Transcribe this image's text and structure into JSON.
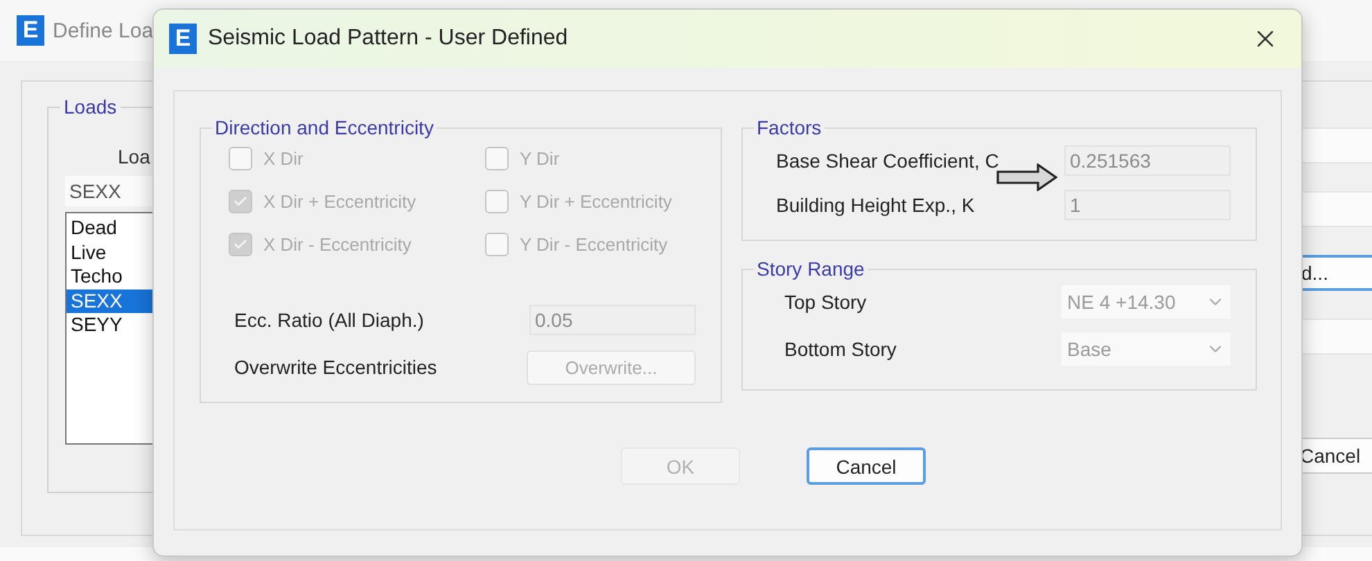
{
  "background_window": {
    "app_letter": "E",
    "title": "Define Loa",
    "loads_group": {
      "title": "Loads",
      "label": "Loa",
      "field_value": "SEXX",
      "items": [
        {
          "label": "Dead",
          "selected": false
        },
        {
          "label": "Live",
          "selected": false
        },
        {
          "label": "Techo",
          "selected": false
        },
        {
          "label": "SEXX",
          "selected": true
        },
        {
          "label": "SEYY",
          "selected": false
        }
      ]
    },
    "side_buttons": [
      "d...",
      "Cancel"
    ]
  },
  "dialog": {
    "app_letter": "E",
    "title": "Seismic Load Pattern - User Defined",
    "direction_group": {
      "title": "Direction and Eccentricity",
      "options": [
        {
          "label": "X Dir",
          "checked": false,
          "disabled": true
        },
        {
          "label": "Y Dir",
          "checked": false,
          "disabled": true
        },
        {
          "label": "X Dir + Eccentricity",
          "checked": true,
          "disabled": true
        },
        {
          "label": "Y Dir + Eccentricity",
          "checked": false,
          "disabled": true
        },
        {
          "label": "X Dir - Eccentricity",
          "checked": true,
          "disabled": true
        },
        {
          "label": "Y Dir - Eccentricity",
          "checked": false,
          "disabled": true
        }
      ],
      "ecc_ratio": {
        "label": "Ecc. Ratio (All Diaph.)",
        "value": "0.05"
      },
      "overwrite": {
        "label": "Overwrite Eccentricities",
        "button": "Overwrite...",
        "disabled": true
      }
    },
    "factors": {
      "title": "Factors",
      "fields": [
        {
          "label": "Base Shear Coefficient, C",
          "value": "0.251563"
        },
        {
          "label": "Building Height Exp., K",
          "value": "1"
        }
      ]
    },
    "story_range": {
      "title": "Story Range",
      "fields": [
        {
          "label": "Top Story",
          "value": "NE 4 +14.30"
        },
        {
          "label": "Bottom Story",
          "value": "Base"
        }
      ]
    },
    "buttons": [
      {
        "label": "OK",
        "disabled": true
      },
      {
        "label": "Cancel",
        "disabled": false
      }
    ]
  }
}
